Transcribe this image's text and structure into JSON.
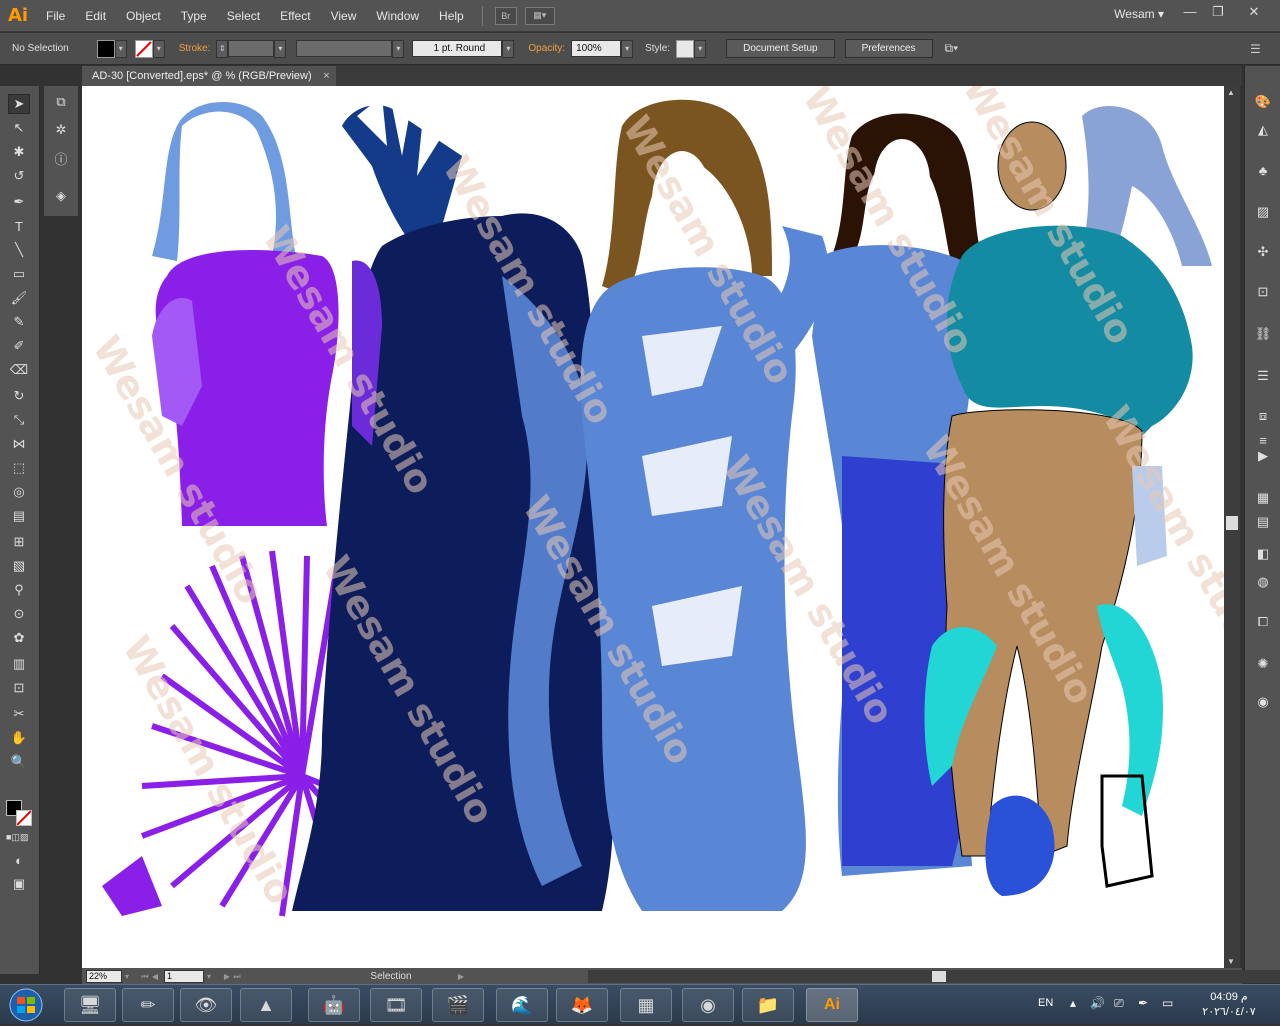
{
  "app": {
    "logo": "Ai"
  },
  "menu": [
    "File",
    "Edit",
    "Object",
    "Type",
    "Select",
    "Effect",
    "View",
    "Window",
    "Help"
  ],
  "menu_buttons": {
    "bridge": "Br"
  },
  "workspace": {
    "label": "Wesam",
    "chevron": "▾"
  },
  "window_controls": {
    "minimize": "—",
    "restore": "❐",
    "close": "✕"
  },
  "control_bar": {
    "selection": "No Selection",
    "stroke_label": "Stroke:",
    "brush": "1 pt. Round",
    "opacity_label": "Opacity:",
    "opacity_value": "100%",
    "style_label": "Style:",
    "document_setup": "Document Setup",
    "preferences": "Preferences"
  },
  "document_tab": {
    "title": "AD-30 [Converted].eps* @ % (RGB/Preview)",
    "close": "×"
  },
  "status_bar": {
    "zoom": "22%",
    "artboard": "1",
    "tool_name": "Selection"
  },
  "taskbar": {
    "language": "EN",
    "time": "م 04:09",
    "date": "٢٠٢٦/٠٤/٠٧",
    "ai_label": "Ai"
  },
  "colors": {
    "accent_orange": "#ff9a00",
    "purple_dress": "#8a1fe8",
    "navy_dress": "#0d1d5c",
    "cornflower": "#5a86d6",
    "teal_top": "#128ba3",
    "skin": "#b78c5e",
    "cyan_accents": "#23d6d6"
  }
}
